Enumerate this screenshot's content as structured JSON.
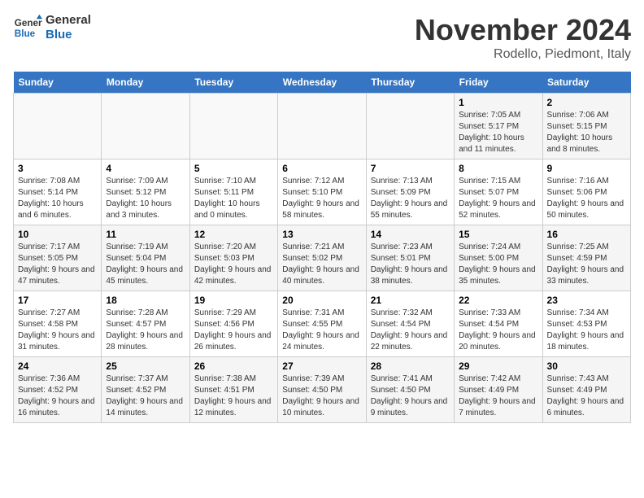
{
  "logo": {
    "line1": "General",
    "line2": "Blue"
  },
  "title": "November 2024",
  "subtitle": "Rodello, Piedmont, Italy",
  "weekdays": [
    "Sunday",
    "Monday",
    "Tuesday",
    "Wednesday",
    "Thursday",
    "Friday",
    "Saturday"
  ],
  "weeks": [
    [
      {
        "day": "",
        "info": ""
      },
      {
        "day": "",
        "info": ""
      },
      {
        "day": "",
        "info": ""
      },
      {
        "day": "",
        "info": ""
      },
      {
        "day": "",
        "info": ""
      },
      {
        "day": "1",
        "info": "Sunrise: 7:05 AM\nSunset: 5:17 PM\nDaylight: 10 hours and 11 minutes."
      },
      {
        "day": "2",
        "info": "Sunrise: 7:06 AM\nSunset: 5:15 PM\nDaylight: 10 hours and 8 minutes."
      }
    ],
    [
      {
        "day": "3",
        "info": "Sunrise: 7:08 AM\nSunset: 5:14 PM\nDaylight: 10 hours and 6 minutes."
      },
      {
        "day": "4",
        "info": "Sunrise: 7:09 AM\nSunset: 5:12 PM\nDaylight: 10 hours and 3 minutes."
      },
      {
        "day": "5",
        "info": "Sunrise: 7:10 AM\nSunset: 5:11 PM\nDaylight: 10 hours and 0 minutes."
      },
      {
        "day": "6",
        "info": "Sunrise: 7:12 AM\nSunset: 5:10 PM\nDaylight: 9 hours and 58 minutes."
      },
      {
        "day": "7",
        "info": "Sunrise: 7:13 AM\nSunset: 5:09 PM\nDaylight: 9 hours and 55 minutes."
      },
      {
        "day": "8",
        "info": "Sunrise: 7:15 AM\nSunset: 5:07 PM\nDaylight: 9 hours and 52 minutes."
      },
      {
        "day": "9",
        "info": "Sunrise: 7:16 AM\nSunset: 5:06 PM\nDaylight: 9 hours and 50 minutes."
      }
    ],
    [
      {
        "day": "10",
        "info": "Sunrise: 7:17 AM\nSunset: 5:05 PM\nDaylight: 9 hours and 47 minutes."
      },
      {
        "day": "11",
        "info": "Sunrise: 7:19 AM\nSunset: 5:04 PM\nDaylight: 9 hours and 45 minutes."
      },
      {
        "day": "12",
        "info": "Sunrise: 7:20 AM\nSunset: 5:03 PM\nDaylight: 9 hours and 42 minutes."
      },
      {
        "day": "13",
        "info": "Sunrise: 7:21 AM\nSunset: 5:02 PM\nDaylight: 9 hours and 40 minutes."
      },
      {
        "day": "14",
        "info": "Sunrise: 7:23 AM\nSunset: 5:01 PM\nDaylight: 9 hours and 38 minutes."
      },
      {
        "day": "15",
        "info": "Sunrise: 7:24 AM\nSunset: 5:00 PM\nDaylight: 9 hours and 35 minutes."
      },
      {
        "day": "16",
        "info": "Sunrise: 7:25 AM\nSunset: 4:59 PM\nDaylight: 9 hours and 33 minutes."
      }
    ],
    [
      {
        "day": "17",
        "info": "Sunrise: 7:27 AM\nSunset: 4:58 PM\nDaylight: 9 hours and 31 minutes."
      },
      {
        "day": "18",
        "info": "Sunrise: 7:28 AM\nSunset: 4:57 PM\nDaylight: 9 hours and 28 minutes."
      },
      {
        "day": "19",
        "info": "Sunrise: 7:29 AM\nSunset: 4:56 PM\nDaylight: 9 hours and 26 minutes."
      },
      {
        "day": "20",
        "info": "Sunrise: 7:31 AM\nSunset: 4:55 PM\nDaylight: 9 hours and 24 minutes."
      },
      {
        "day": "21",
        "info": "Sunrise: 7:32 AM\nSunset: 4:54 PM\nDaylight: 9 hours and 22 minutes."
      },
      {
        "day": "22",
        "info": "Sunrise: 7:33 AM\nSunset: 4:54 PM\nDaylight: 9 hours and 20 minutes."
      },
      {
        "day": "23",
        "info": "Sunrise: 7:34 AM\nSunset: 4:53 PM\nDaylight: 9 hours and 18 minutes."
      }
    ],
    [
      {
        "day": "24",
        "info": "Sunrise: 7:36 AM\nSunset: 4:52 PM\nDaylight: 9 hours and 16 minutes."
      },
      {
        "day": "25",
        "info": "Sunrise: 7:37 AM\nSunset: 4:52 PM\nDaylight: 9 hours and 14 minutes."
      },
      {
        "day": "26",
        "info": "Sunrise: 7:38 AM\nSunset: 4:51 PM\nDaylight: 9 hours and 12 minutes."
      },
      {
        "day": "27",
        "info": "Sunrise: 7:39 AM\nSunset: 4:50 PM\nDaylight: 9 hours and 10 minutes."
      },
      {
        "day": "28",
        "info": "Sunrise: 7:41 AM\nSunset: 4:50 PM\nDaylight: 9 hours and 9 minutes."
      },
      {
        "day": "29",
        "info": "Sunrise: 7:42 AM\nSunset: 4:49 PM\nDaylight: 9 hours and 7 minutes."
      },
      {
        "day": "30",
        "info": "Sunrise: 7:43 AM\nSunset: 4:49 PM\nDaylight: 9 hours and 6 minutes."
      }
    ]
  ]
}
